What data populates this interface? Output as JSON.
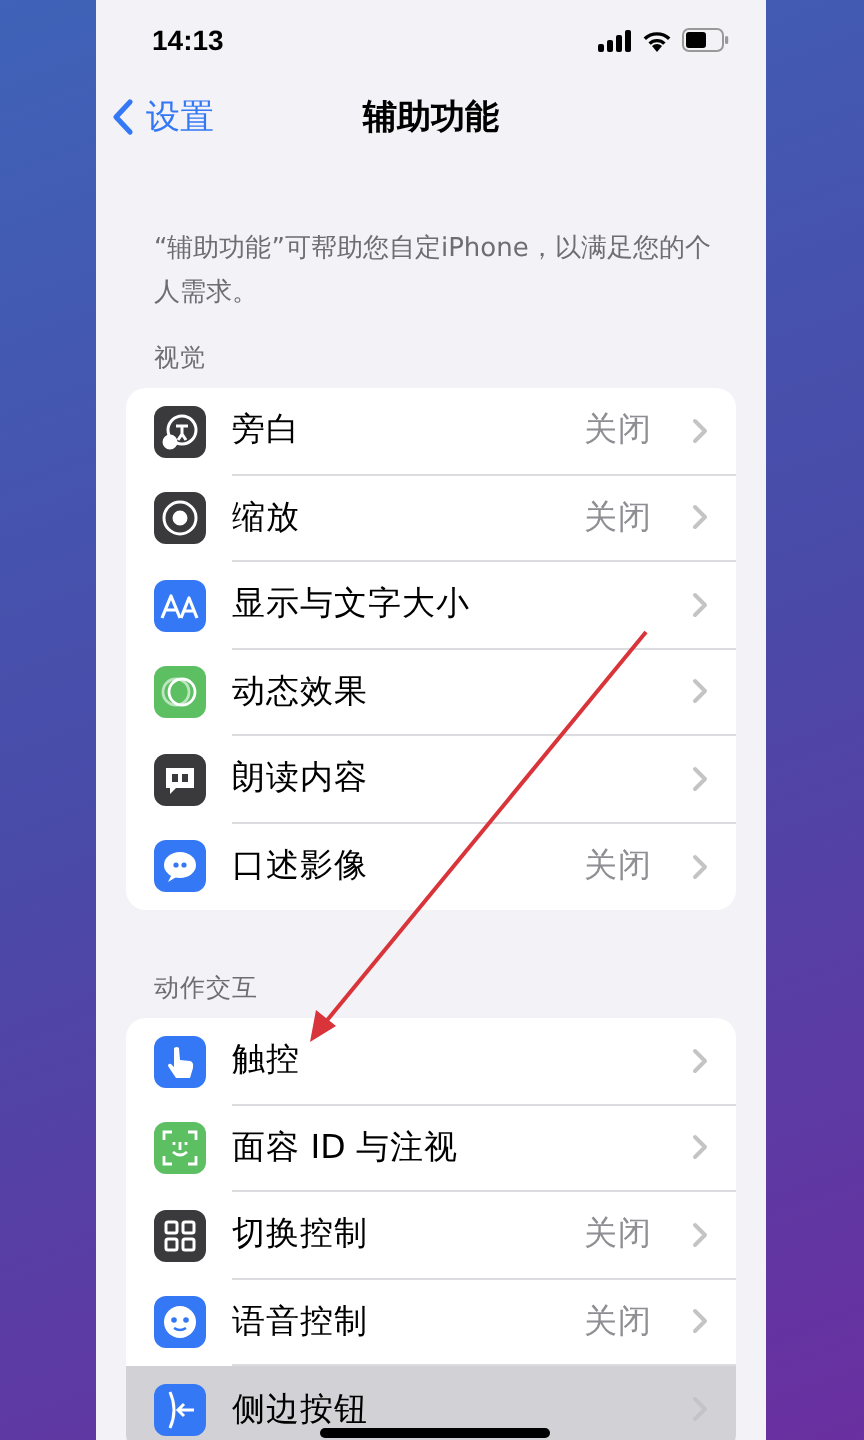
{
  "status_bar": {
    "time": "14:13"
  },
  "nav": {
    "back": "设置",
    "title": "辅助功能"
  },
  "description": "“辅助功能”可帮助您自定iPhone，以满足您的个人需求。",
  "sections": [
    {
      "header": "视觉",
      "rows": [
        {
          "label": "旁白",
          "value": "关闭",
          "color": "#3a3a3c",
          "selected": false
        },
        {
          "label": "缩放",
          "value": "关闭",
          "color": "#3a3a3c",
          "selected": false
        },
        {
          "label": "显示与文字大小",
          "color": "#3478f6",
          "selected": false
        },
        {
          "label": "动态效果",
          "color": "#5cbf62",
          "selected": false
        },
        {
          "label": "朗读内容",
          "color": "#3a3a3c",
          "selected": false
        },
        {
          "label": "口述影像",
          "value": "关闭",
          "color": "#3478f6",
          "selected": false
        }
      ]
    },
    {
      "header": "动作交互",
      "rows": [
        {
          "label": "触控",
          "color": "#3478f6",
          "selected": false
        },
        {
          "label": "面容 ID 与注视",
          "color": "#5cbf62",
          "selected": false
        },
        {
          "label": "切换控制",
          "value": "关闭",
          "color": "#3a3a3c",
          "selected": false
        },
        {
          "label": "语音控制",
          "value": "关闭",
          "color": "#3478f6",
          "selected": false
        },
        {
          "label": "侧边按钮",
          "color": "#3478f6",
          "selected": true
        }
      ]
    }
  ]
}
